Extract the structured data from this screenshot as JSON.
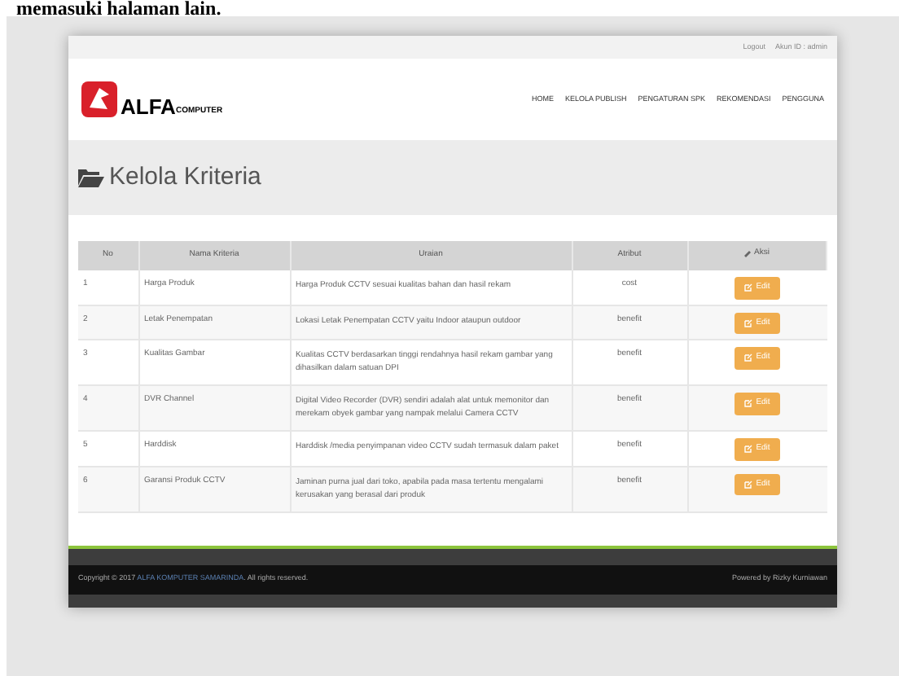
{
  "document_text": "memasuki halaman lain.",
  "top_bar": {
    "logout": "Logout",
    "account": "Akun ID : admin"
  },
  "logo": {
    "name": "ALFA",
    "suffix": "COMPUTER"
  },
  "nav": [
    "HOME",
    "KELOLA PUBLISH",
    "PENGATURAN SPK",
    "REKOMENDASI",
    "PENGGUNA"
  ],
  "page_title": "Kelola Kriteria",
  "table": {
    "columns": [
      "No",
      "Nama Kriteria",
      "Uraian",
      "Atribut",
      "Aksi"
    ],
    "rows": [
      {
        "no": "1",
        "nama": "Harga Produk",
        "uraian": "Harga Produk CCTV sesuai kualitas bahan dan hasil rekam",
        "atribut": "cost",
        "action": "Edit"
      },
      {
        "no": "2",
        "nama": "Letak Penempatan",
        "uraian": "Lokasi Letak Penempatan CCTV yaitu Indoor ataupun outdoor",
        "atribut": "benefit",
        "action": "Edit"
      },
      {
        "no": "3",
        "nama": "Kualitas Gambar",
        "uraian": "Kualitas CCTV berdasarkan tinggi rendahnya hasil rekam gambar yang dihasilkan dalam satuan DPI",
        "atribut": "benefit",
        "action": "Edit"
      },
      {
        "no": "4",
        "nama": "DVR Channel",
        "uraian": "Digital Video Recorder (DVR) sendiri adalah alat untuk memonitor dan merekam obyek gambar yang nampak melalui Camera CCTV",
        "atribut": "benefit",
        "action": "Edit"
      },
      {
        "no": "5",
        "nama": "Harddisk",
        "uraian": "Harddisk /media penyimpanan video CCTV sudah termasuk dalam paket",
        "atribut": "benefit",
        "action": "Edit"
      },
      {
        "no": "6",
        "nama": "Garansi Produk CCTV",
        "uraian": "Jaminan purna jual dari toko, apabila pada masa tertentu mengalami kerusakan yang berasal dari produk",
        "atribut": "benefit",
        "action": "Edit"
      }
    ]
  },
  "footer": {
    "copyright": "Copyright © 2017",
    "company": "ALFA KOMPUTER SAMARINDA",
    "rights": ". All rights reserved.",
    "powered": "Powered by Rizky Kurniawan"
  }
}
